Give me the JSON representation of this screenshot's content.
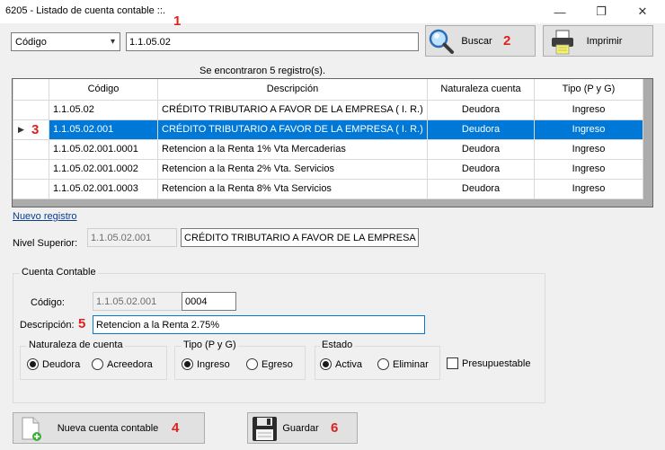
{
  "window": {
    "title": "6205 - Listado de cuenta contable ::.",
    "minimize_glyph": "—",
    "maximize_glyph": "❐",
    "close_glyph": "✕"
  },
  "search": {
    "field_selected": "Código",
    "query_value": "1.1.05.02",
    "search_label": "Buscar",
    "print_label": "Imprimir"
  },
  "results": {
    "count_text": "Se encontraron 5 registro(s).",
    "columns": [
      "Código",
      "Descripción",
      "Naturaleza cuenta",
      "Tipo (P y G)"
    ],
    "rows": [
      {
        "codigo": "1.1.05.02",
        "descripcion": "CRÉDITO TRIBUTARIO A FAVOR DE LA EMPRESA ( I. R.)",
        "naturaleza": "Deudora",
        "tipo": "Ingreso"
      },
      {
        "codigo": "1.1.05.02.001",
        "descripcion": "CRÉDITO TRIBUTARIO A FAVOR DE LA EMPRESA ( I. R.)",
        "naturaleza": "Deudora",
        "tipo": "Ingreso"
      },
      {
        "codigo": "1.1.05.02.001.0001",
        "descripcion": "Retencion a la Renta 1% Vta Mercaderias",
        "naturaleza": "Deudora",
        "tipo": "Ingreso"
      },
      {
        "codigo": "1.1.05.02.001.0002",
        "descripcion": "Retencion a la Renta 2% Vta. Servicios",
        "naturaleza": "Deudora",
        "tipo": "Ingreso"
      },
      {
        "codigo": "1.1.05.02.001.0003",
        "descripcion": "Retencion a la Renta 8% Vta Servicios",
        "naturaleza": "Deudora",
        "tipo": "Ingreso"
      }
    ],
    "selected_row": 1
  },
  "form": {
    "new_record_link": "Nuevo registro",
    "nivel_superior_label": "Nivel Superior:",
    "nivel_superior_code": "1.1.05.02.001",
    "nivel_superior_desc": "CRÉDITO TRIBUTARIO A FAVOR DE LA EMPRESA ( I.",
    "group_title": "Cuenta Contable",
    "codigo_label": "Código:",
    "codigo_prefix": "1.1.05.02.001",
    "codigo_suffix": "0004",
    "descripcion_label": "Descripción:",
    "descripcion_value": "Retencion a la Renta 2.75%",
    "naturaleza": {
      "title": "Naturaleza de cuenta",
      "options": [
        "Deudora",
        "Acreedora"
      ],
      "selected": "Deudora"
    },
    "tipo": {
      "title": "Tipo (P y G)",
      "options": [
        "Ingreso",
        "Egreso"
      ],
      "selected": "Ingreso"
    },
    "estado": {
      "title": "Estado",
      "options": [
        "Activa",
        "Eliminar"
      ],
      "selected": "Activa"
    },
    "presupuestable_label": "Presupuestable",
    "presupuestable_checked": false
  },
  "actions": {
    "new_label": "Nueva cuenta contable",
    "save_label": "Guardar"
  },
  "annotations": [
    "1",
    "2",
    "3",
    "4",
    "5",
    "6"
  ],
  "colors": {
    "selection": "#0078d7",
    "annotation": "#e0201c",
    "background": "#f0f0f0"
  }
}
